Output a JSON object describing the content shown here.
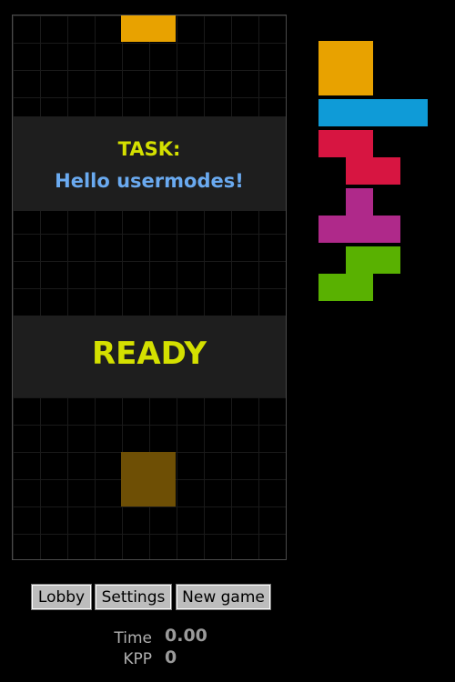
{
  "game": {
    "task_title": "TASK:",
    "task_text": "Hello usermodes!",
    "ready_text": "READY",
    "falling_piece_color": "#e8a200",
    "ghost_piece_color": "#6e4f05"
  },
  "next_queue": [
    {
      "piece": "O",
      "color": "#e8a200"
    },
    {
      "piece": "I",
      "color": "#0f9bd7"
    },
    {
      "piece": "Z",
      "color": "#d71541"
    },
    {
      "piece": "T",
      "color": "#af298a"
    },
    {
      "piece": "S",
      "color": "#59b101"
    }
  ],
  "buttons": {
    "lobby": "Lobby",
    "settings": "Settings",
    "new_game": "New game"
  },
  "stats": {
    "time_label": "Time",
    "time_value": "0.00",
    "kpp_label": "KPP",
    "kpp_value": "0"
  }
}
